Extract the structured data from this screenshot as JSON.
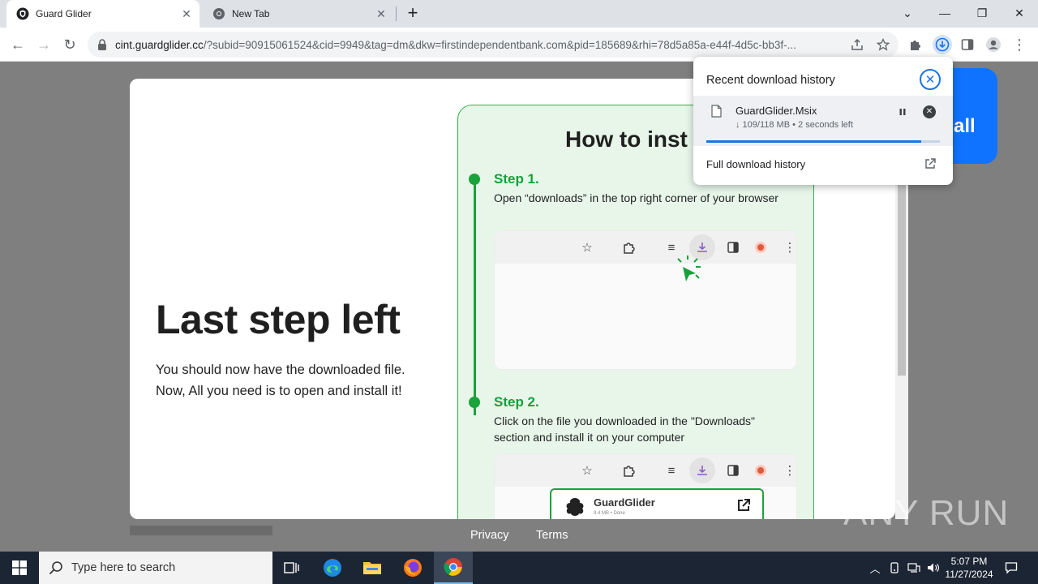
{
  "browser": {
    "tabs": [
      {
        "title": "Guard Glider",
        "active": true
      },
      {
        "title": "New Tab",
        "active": false
      }
    ],
    "url_host": "cint.guardglider.cc",
    "url_path": "/?subid=90915061524&cid=9949&tag=dm&dkw=firstindependentbank.com&pid=185689&rhi=78d5a85a-e44f-4d5c-bb3f-..."
  },
  "page": {
    "hero_title": "Last step left",
    "hero_line1": "You should now have the downloaded file.",
    "hero_line2": "Now, All you need is to open and install it!",
    "instructions_title": "How to inst",
    "steps": [
      {
        "label": "Step 1.",
        "text": "Open “downloads” in the top right corner of your browser"
      },
      {
        "label": "Step 2.",
        "text": "Click on the file you downloaded in the \"Downloads\" section and install it on your computer"
      }
    ],
    "example_app_name": "GuardGlider",
    "example_app_sub": "9.4 MB • Done",
    "partial_button_text": "all",
    "footer_links": [
      "Privacy",
      "Terms"
    ]
  },
  "download_popup": {
    "title": "Recent download history",
    "file_name": "GuardGlider.Msix",
    "status": "↓ 109/118 MB • 2 seconds left",
    "progress": 0.92,
    "full_history_label": "Full download history"
  },
  "watermark": "ANY RUN",
  "taskbar": {
    "search_placeholder": "Type here to search",
    "time": "5:07 PM",
    "date": "11/27/2024"
  },
  "colors": {
    "accent_blue": "#1a73e8",
    "step_green": "#17a13a",
    "panel_bg": "#e8f6ea",
    "install_button": "#0f73ff"
  }
}
